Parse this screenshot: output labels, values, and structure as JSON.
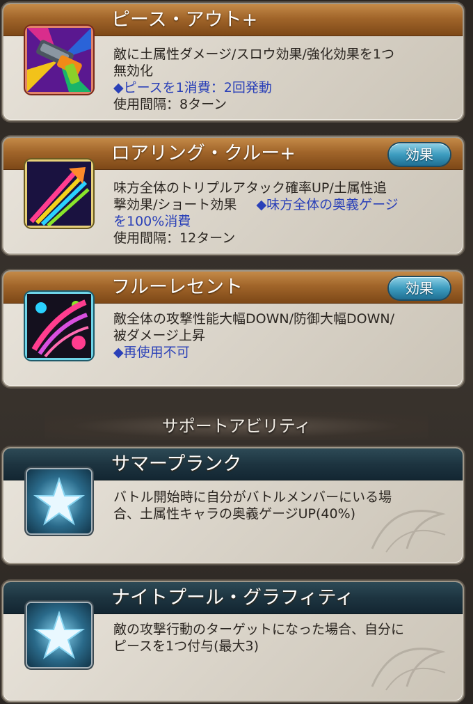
{
  "skills": [
    {
      "name": "ピース・アウト+",
      "line1": "敵に土属性ダメージ/スロウ効果/強化効果を1つ",
      "line2": "無効化",
      "note": "◆ピースを1消費：2回発動",
      "interval": "使用間隔：8ターン",
      "icon": "water-gun-icon"
    },
    {
      "name": "ロアリング・クルー+",
      "effect_label": "効果",
      "line1": "味方全体のトリプルアタック確率UP/土属性追",
      "line2_text": "撃効果/ショート効果",
      "line2_note": "◆味方全体の奥義ゲージ",
      "line3_note": "を100%消費",
      "interval": "使用間隔：12ターン",
      "icon": "neon-arrow-icon"
    },
    {
      "name": "フルーレセント",
      "effect_label": "効果",
      "line1": "敵全体の攻撃性能大幅DOWN/防御大幅DOWN/",
      "line2": "被ダメージ上昇",
      "note": "◆再使用不可",
      "icon": "neon-slash-icon"
    }
  ],
  "support_title": "サポートアビリティ",
  "supports": [
    {
      "name": "サマープランク",
      "line1": "バトル開始時に自分がバトルメンバーにいる場",
      "line2": "合、土属性キャラの奥義ゲージUP(40%)",
      "icon": "star-icon"
    },
    {
      "name": "ナイトプール・グラフィティ",
      "line1": "敵の攻撃行動のターゲットになった場合、自分に",
      "line2": "ピースを1つ付与(最大3)",
      "icon": "star-icon"
    }
  ]
}
